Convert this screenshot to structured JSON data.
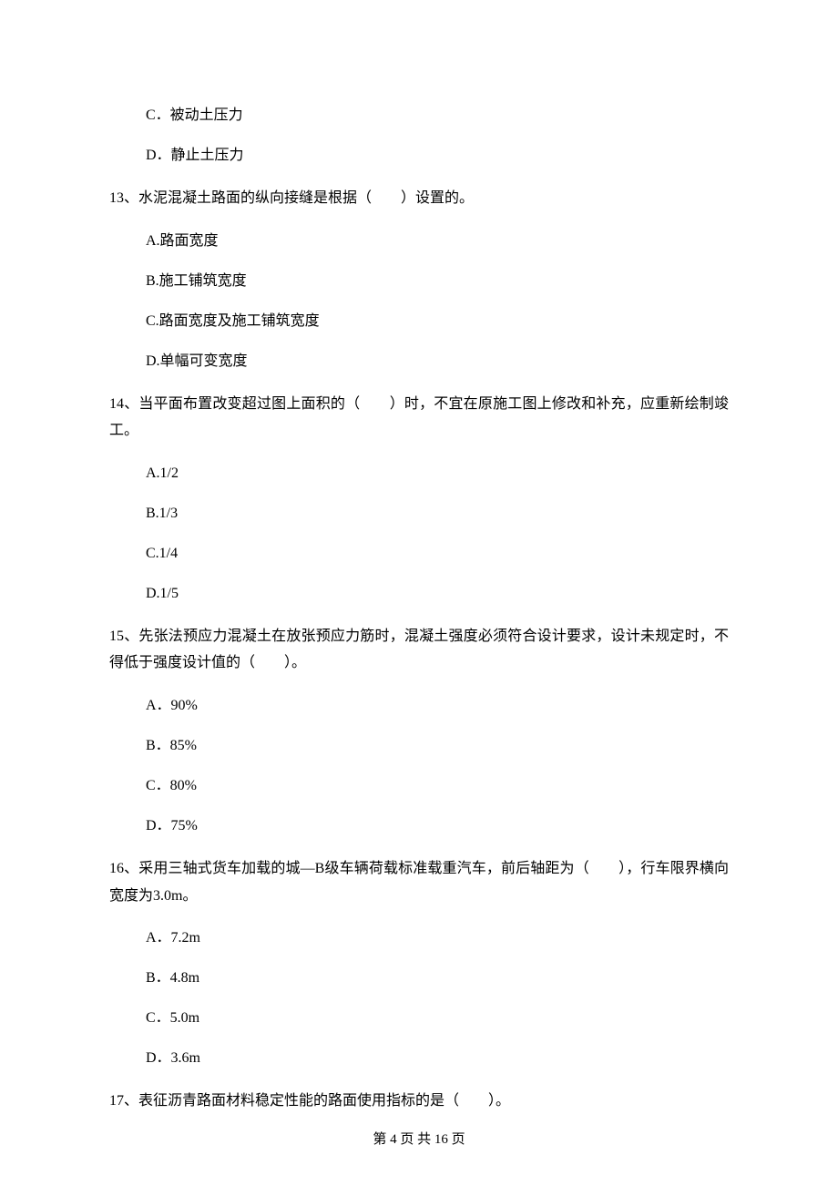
{
  "options_pre": [
    "C．被动土压力",
    "D．静止土压力"
  ],
  "q13": {
    "stem": "13、水泥混凝土路面的纵向接缝是根据（　　）设置的。",
    "options": [
      "A.路面宽度",
      "B.施工铺筑宽度",
      "C.路面宽度及施工铺筑宽度",
      "D.单幅可变宽度"
    ]
  },
  "q14": {
    "stem": "14、当平面布置改变超过图上面积的（　　）时，不宜在原施工图上修改和补充，应重新绘制竣工。",
    "options": [
      "A.1/2",
      "B.1/3",
      "C.1/4",
      "D.1/5"
    ]
  },
  "q15": {
    "stem": "15、先张法预应力混凝土在放张预应力筋时，混凝土强度必须符合设计要求，设计未规定时，不得低于强度设计值的（　　）。",
    "options": [
      "A．90%",
      "B．85%",
      "C．80%",
      "D．75%"
    ]
  },
  "q16": {
    "stem": "16、采用三轴式货车加载的城—B级车辆荷载标准载重汽车，前后轴距为（　　），行车限界横向宽度为3.0m。",
    "options": [
      "A．7.2m",
      "B．4.8m",
      "C．5.0m",
      "D．3.6m"
    ]
  },
  "q17": {
    "stem": "17、表征沥青路面材料稳定性能的路面使用指标的是（　　）。"
  },
  "footer": "第 4 页 共 16 页"
}
